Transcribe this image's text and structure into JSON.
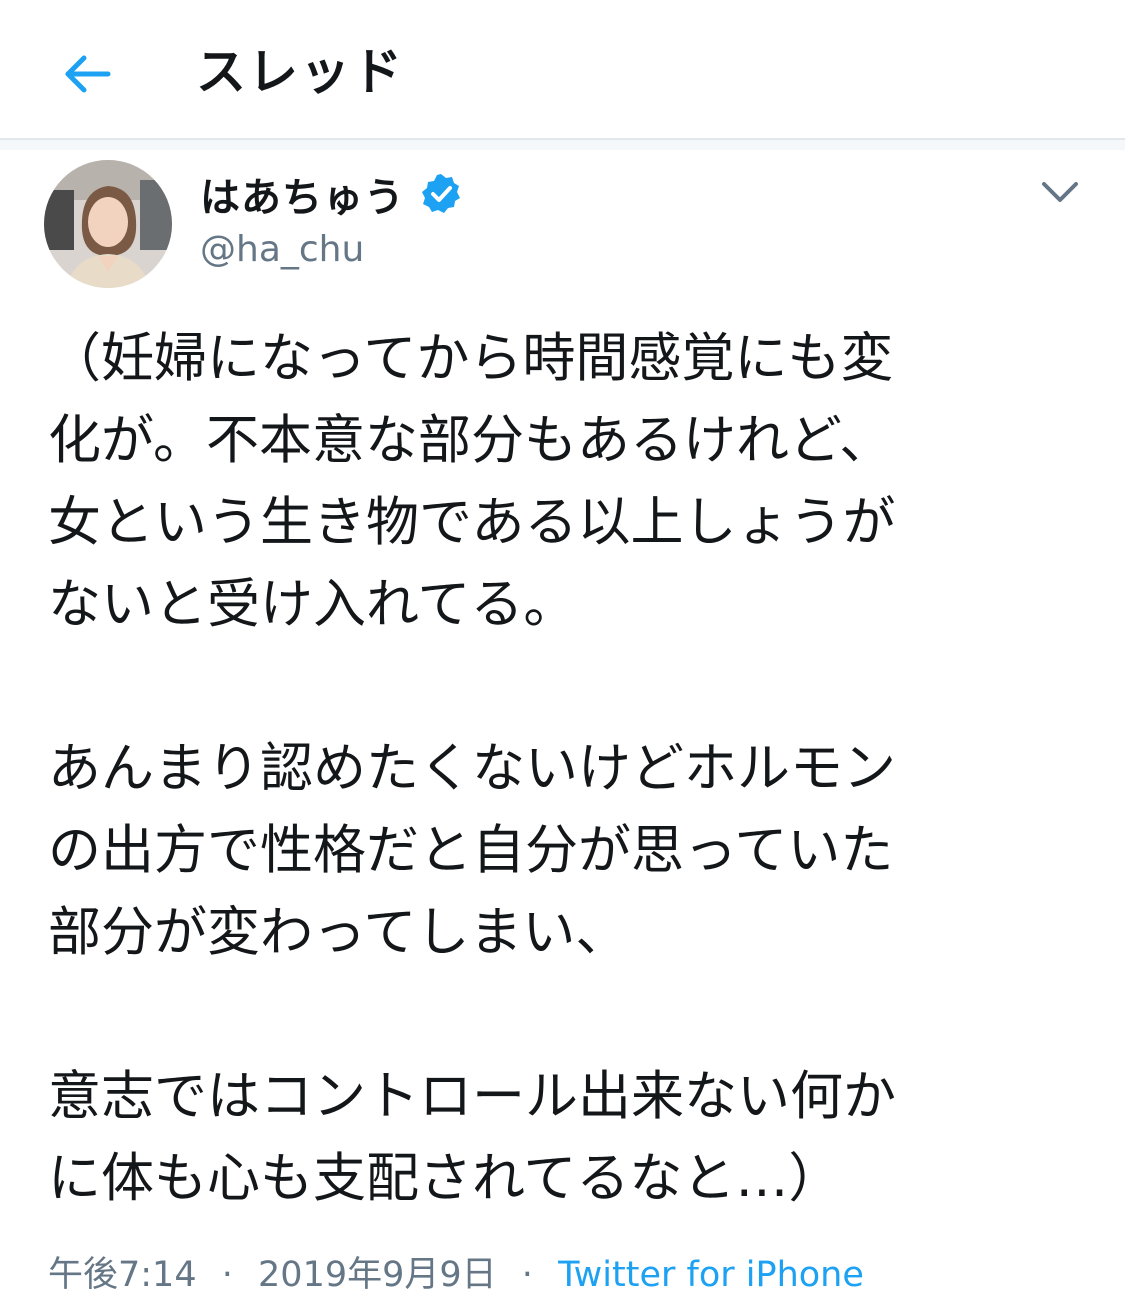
{
  "header": {
    "title": "スレッド"
  },
  "tweet": {
    "display_name": "はあちゅう",
    "handle": "@ha_chu",
    "text_lines": [
      "（妊婦になってから時間感覚にも変",
      "化が。不本意な部分もあるけれど、",
      "女という生き物である以上しょうが",
      "ないと受け入れてる。",
      "",
      "あんまり認めたくないけどホルモン",
      "の出方で性格だと自分が思っていた",
      "部分が変わってしまい、",
      "",
      "意志ではコントロール出来ない何か",
      "に体も心も支配されてるなと…）"
    ],
    "time": "午後7:14",
    "date": "2019年9月9日",
    "separator": "·",
    "source": "Twitter for iPhone"
  },
  "icons": {
    "back": "arrow-left-icon",
    "verified": "verified-badge-icon",
    "more": "chevron-down-icon"
  },
  "colors": {
    "accent": "#1da1f2",
    "text": "#14171a",
    "secondary": "#657786",
    "border": "#e1e8ed"
  }
}
